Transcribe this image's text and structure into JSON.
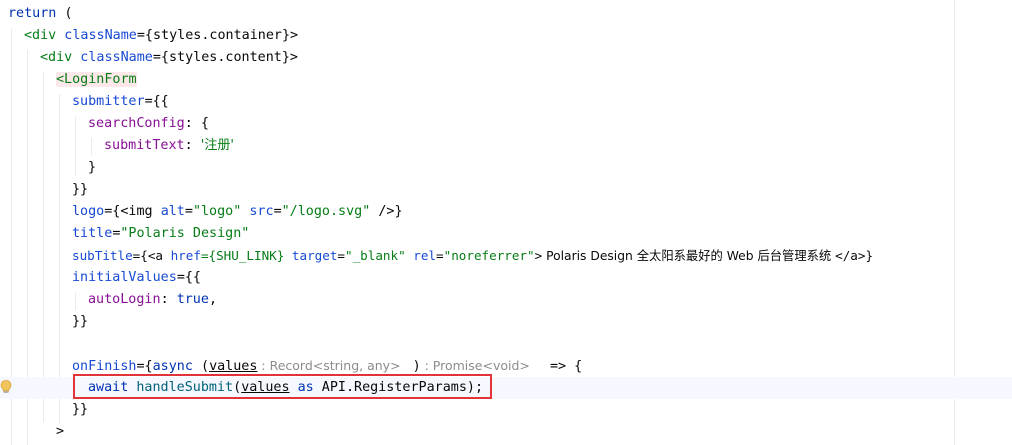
{
  "code": {
    "l1_return": "return",
    "l1_paren": " (",
    "l2_open": "<div",
    "l2_attr": " className",
    "l2_val": "={styles.container}>",
    "l3_open": "<div",
    "l3_attr": " className",
    "l3_val": "={styles.content}>",
    "l4_tag": "<LoginForm",
    "l5_attr": "submitter",
    "l5_val": "={{",
    "l6_prop": "searchConfig",
    "l6_val": ": {",
    "l7_prop": "submitText",
    "l7_colon": ": ",
    "l7_str": "'注册'",
    "l8_close": "}",
    "l9_close": "}}",
    "l10_attr": "logo",
    "l10_a": "={<img ",
    "l10_alt": "alt",
    "l10_eq1": "=",
    "l10_altv": "\"logo\"",
    "l10_src": " src",
    "l10_eq2": "=",
    "l10_srcv": "\"/logo.svg\"",
    "l10_end": " />}",
    "l11_attr": "title",
    "l11_eq": "=",
    "l11_val": "\"Polaris Design\"",
    "l12_attr": "subTitle",
    "l12_a": "={<a ",
    "l12_href": "href",
    "l12_hv": "={SHU_LINK}",
    "l12_target": " target",
    "l12_eq": "=",
    "l12_tv": "\"_blank\"",
    "l12_rel": " rel",
    "l12_eq2": "=",
    "l12_rv": "\"noreferrer\"",
    "l12_gt": ">",
    "l12_text": " Polaris Design 全太阳系最好的 Web 后台管理系统 ",
    "l12_close": "</a>}",
    "l13_attr": "initialValues",
    "l13_val": "={{",
    "l14_prop": "autoLogin",
    "l14_colon": ": ",
    "l14_kw": "true",
    "l14_comma": ",",
    "l15_close": "}}",
    "l17_attr": "onFinish",
    "l17_eq": "={",
    "l17_async": "async",
    "l17_open": " (",
    "l17_param": "values",
    "l17_hint1": " : Record<string, any> ",
    "l17_close": " )",
    "l17_hint2": " : Promise<void> ",
    "l17_arrow": "  => {",
    "l18_await": "await",
    "l18_fn": " handleSubmit",
    "l18_open": "(",
    "l18_param": "values",
    "l18_as": " as",
    "l18_rest": " API.RegisterParams);",
    "l19_close": "}}",
    "l20_close": ">"
  },
  "colors": {
    "keyword": "#0033b3",
    "tag": "#067d17",
    "attribute": "#174ad4",
    "property": "#871094",
    "highlight_border": "#e0333a"
  },
  "icons": {
    "gutter": "lightbulb-icon"
  }
}
